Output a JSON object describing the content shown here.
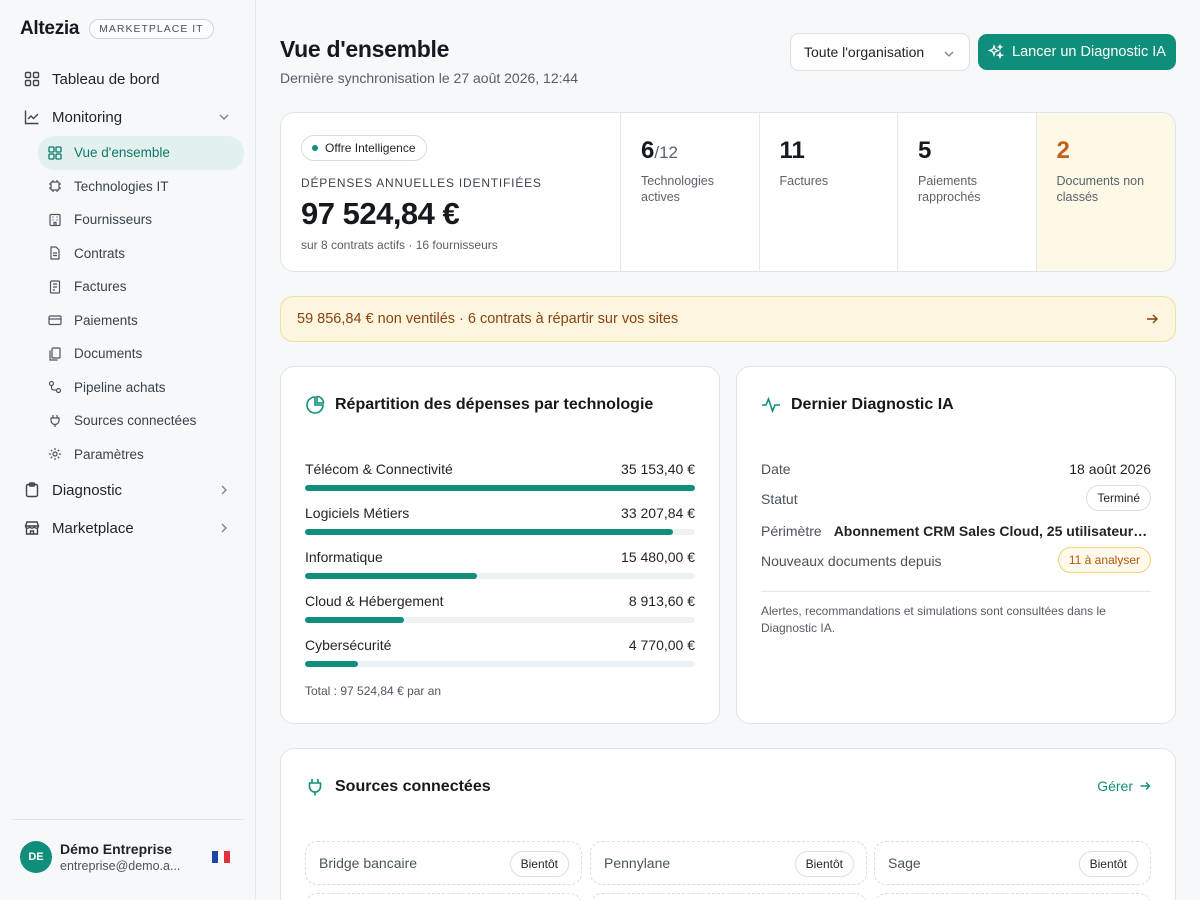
{
  "brand": {
    "name": "Altezia",
    "badge": "MARKETPLACE IT"
  },
  "sidebar": {
    "top_items": [
      {
        "label": "Tableau de bord",
        "icon": "dashboard-icon"
      },
      {
        "label": "Monitoring",
        "icon": "chart-line-icon"
      }
    ],
    "monitoring_items": [
      {
        "label": "Vue d'ensemble",
        "icon": "grid-icon",
        "active": true
      },
      {
        "label": "Technologies IT",
        "icon": "chip-icon"
      },
      {
        "label": "Fournisseurs",
        "icon": "building-icon"
      },
      {
        "label": "Contrats",
        "icon": "file-icon"
      },
      {
        "label": "Factures",
        "icon": "invoice-icon"
      },
      {
        "label": "Paiements",
        "icon": "credit-card-icon"
      },
      {
        "label": "Documents",
        "icon": "documents-icon"
      },
      {
        "label": "Pipeline achats",
        "icon": "workflow-icon"
      },
      {
        "label": "Sources connectées",
        "icon": "plug-icon"
      },
      {
        "label": "Paramètres",
        "icon": "gear-icon"
      }
    ],
    "bottom_items": [
      {
        "label": "Diagnostic",
        "icon": "clipboard-icon"
      },
      {
        "label": "Marketplace",
        "icon": "store-icon"
      }
    ],
    "user": {
      "initials": "DE",
      "name": "Démo Entreprise",
      "email": "entreprise@demo.a..."
    }
  },
  "header": {
    "title": "Vue d'ensemble",
    "subtitle": "Dernière synchronisation le 27 août 2026, 12:44",
    "scope_select": "Toute l'organisation",
    "cta_label": "Lancer un Diagnostic IA"
  },
  "stats": {
    "offer_pill": "Offre Intelligence",
    "spend_label": "DÉPENSES ANNUELLES IDENTIFIÉES",
    "spend_value": "97 524,84 €",
    "spend_sub": "sur 8 contrats actifs · 16 fournisseurs",
    "cards": [
      {
        "num": "6",
        "den": "/12",
        "desc": "Technologies actives"
      },
      {
        "num": "11",
        "den": "",
        "desc": "Factures"
      },
      {
        "num": "5",
        "den": "",
        "desc": "Paiements rapprochés"
      },
      {
        "num": "2",
        "den": "",
        "desc": "Documents non classés"
      }
    ]
  },
  "banner": {
    "text": "59 856,84 € non ventilés · 6 contrats à répartir sur vos sites"
  },
  "spend_card": {
    "title": "Répartition des dépenses par technologie",
    "total": "Total : 97 524,84 € par an"
  },
  "chart_data": {
    "type": "bar",
    "categories": [
      "Télécom & Connectivité",
      "Logiciels Métiers",
      "Informatique",
      "Cloud & Hébergement",
      "Cybersécurité"
    ],
    "values": [
      35153.4,
      33207.84,
      15480.0,
      8913.6,
      4770.0
    ],
    "value_labels": [
      "35 153,40 €",
      "33 207,84 €",
      "15 480,00 €",
      "8 913,60 €",
      "4 770,00 €"
    ],
    "xlim": [
      0,
      35153.4
    ],
    "accent": "#0f8f7b"
  },
  "diagnostic": {
    "title": "Dernier Diagnostic IA",
    "rows": {
      "date_label": "Date",
      "date_value": "18 août 2026",
      "status_label": "Statut",
      "status_value": "Terminé",
      "scope_label": "Périmètre",
      "scope_value": "Abonnement CRM Sales Cloud, 25 utilisateurs...",
      "docs_label": "Nouveaux documents depuis",
      "docs_value": "11 à analyser"
    },
    "note": "Alertes, recommandations et simulations sont consultées dans le Diagnostic IA."
  },
  "sources": {
    "title": "Sources connectées",
    "manage": "Gérer",
    "items": [
      {
        "name": "Bridge bancaire",
        "badge": "Bientôt"
      },
      {
        "name": "Pennylane",
        "badge": "Bientôt"
      },
      {
        "name": "Sage",
        "badge": "Bientôt"
      }
    ]
  },
  "colors": {
    "accent": "#0f8f7b",
    "warn": "#c2611a",
    "banner_bg": "#fdf6df"
  }
}
